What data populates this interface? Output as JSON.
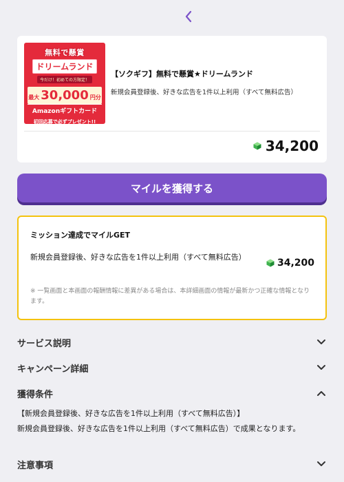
{
  "header": {
    "back_icon": "chevron-left-icon",
    "accent": "#7b52c9"
  },
  "offer": {
    "banner": {
      "top_text": "無料で懸賞",
      "title_text": "ドリームランド",
      "sub_text": "今だけ！初めての方限定！",
      "max_label": "最大",
      "amount": "30,000",
      "unit": "円分",
      "gift_text": "Amazonギフトカード",
      "foot_text": "初回応募で必ずプレゼント!!"
    },
    "title": "【ソクギフ】無料で懸賞★ドリームランド",
    "description": "新規会員登録後、好きな広告を1件以上利用（すべて無料広告）",
    "reward": "34,200",
    "reward_icon": "green-gem-icon"
  },
  "cta": {
    "label": "マイルを獲得する"
  },
  "mission": {
    "heading": "ミッション達成でマイルGET",
    "text": "新規会員登録後、好きな広告を1件以上利用（すべて無料広告）",
    "reward": "34,200",
    "note": "※ 一覧画面と本画面の報酬情報に差異がある場合は、本詳細画面の情報が最新かつ正確な情報となります。",
    "border_color": "#f4c20d"
  },
  "accordion": {
    "service": {
      "label": "サービス説明",
      "expanded": false
    },
    "campaign": {
      "label": "キャンペーン詳細",
      "expanded": false
    },
    "conditions": {
      "label": "獲得条件",
      "expanded": true,
      "line1": "【新規会員登録後、好きな広告を1件以上利用（すべて無料広告）】",
      "line2": "新規会員登録後、好きな広告を1件以上利用（すべて無料広告）で成果となります。"
    },
    "notes": {
      "label": "注意事項",
      "expanded": false
    }
  }
}
